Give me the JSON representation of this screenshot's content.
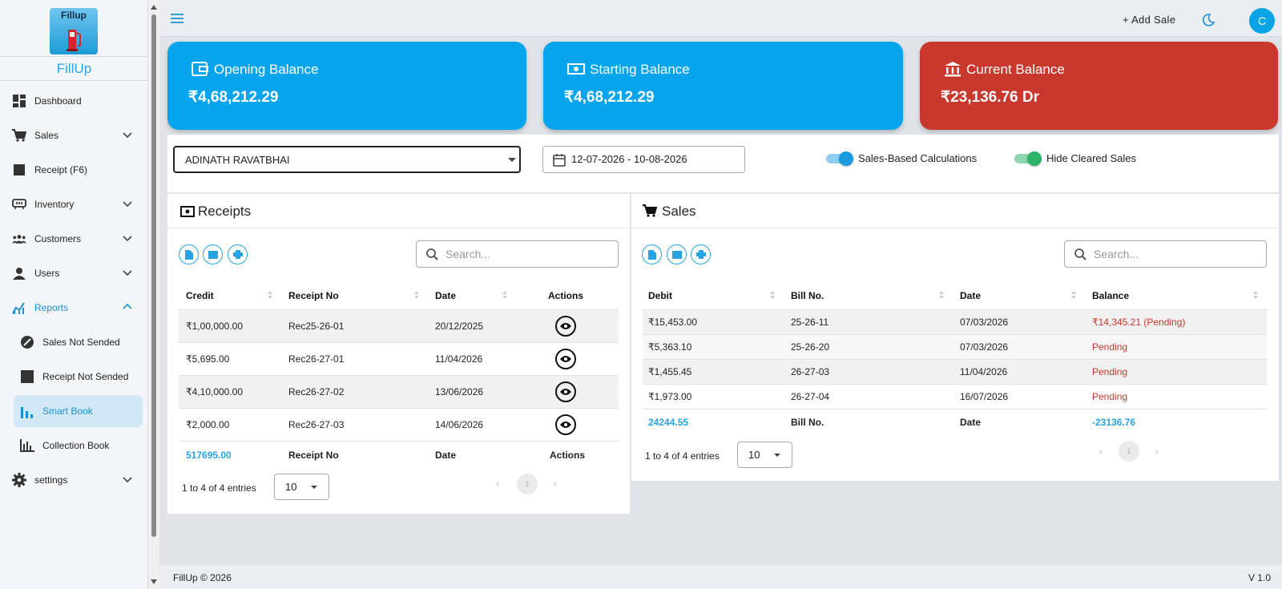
{
  "app": {
    "logo_text": "Fillup",
    "name": "FillUp"
  },
  "sidebar": {
    "items": [
      {
        "label": "Dashboard"
      },
      {
        "label": "Sales"
      },
      {
        "label": "Receipt (F6)"
      },
      {
        "label": "Inventory"
      },
      {
        "label": "Customers"
      },
      {
        "label": "Users"
      },
      {
        "label": "Reports"
      },
      {
        "label": "Sales Not Sended"
      },
      {
        "label": "Receipt Not Sended"
      },
      {
        "label": "Smart Book"
      },
      {
        "label": "Collection Book"
      },
      {
        "label": "settings"
      }
    ]
  },
  "topbar": {
    "add_sale": "+ Add Sale",
    "avatar_letter": "C"
  },
  "cards": [
    {
      "title": "Opening Balance",
      "value": "₹4,68,212.29",
      "color": "#05a4ec"
    },
    {
      "title": "Starting Balance",
      "value": "₹4,68,212.29",
      "color": "#05a4ec"
    },
    {
      "title": "Current Balance",
      "value": "₹23,136.76 Dr",
      "color": "#c8382d"
    }
  ],
  "filters": {
    "customer": "ADINATH RAVATBHAI",
    "date_range": "12-07-2026 - 10-08-2026",
    "toggle1": "Sales-Based Calculations",
    "toggle2": "Hide Cleared Sales"
  },
  "receipts": {
    "title": "Receipts",
    "search_placeholder": "Search...",
    "headers": [
      "Credit",
      "Receipt No",
      "Date",
      "Actions"
    ],
    "rows": [
      [
        "₹1,00,000.00",
        "Rec25-26-01",
        "20/12/2025"
      ],
      [
        "₹5,695.00",
        "Rec26-27-01",
        "11/04/2026"
      ],
      [
        "₹4,10,000.00",
        "Rec26-27-02",
        "13/06/2026"
      ],
      [
        "₹2,000.00",
        "Rec26-27-03",
        "14/06/2026"
      ]
    ],
    "footer": [
      "517695.00",
      "Receipt No",
      "Date",
      "Actions"
    ],
    "entries": "1 to 4 of 4 entries",
    "page_size": "10",
    "page": "1"
  },
  "sales": {
    "title": "Sales",
    "search_placeholder": "Search...",
    "headers": [
      "Debit",
      "Bill No.",
      "Date",
      "Balance"
    ],
    "rows": [
      [
        "₹15,453.00",
        "25-26-11",
        "07/03/2026",
        "₹14,345.21 (Pending)"
      ],
      [
        "₹5,363.10",
        "25-26-20",
        "07/03/2026",
        "Pending"
      ],
      [
        "₹1,455.45",
        "26-27-03",
        "11/04/2026",
        "Pending"
      ],
      [
        "₹1,973.00",
        "26-27-04",
        "16/07/2026",
        "Pending"
      ]
    ],
    "footer": [
      "24244.55",
      "Bill No.",
      "Date",
      "-23136.76"
    ],
    "entries": "1 to 4 of 4 entries",
    "page_size": "10",
    "page": "1"
  },
  "footer": {
    "copyright": "FillUp © 2026",
    "version": "V 1.0"
  },
  "colors": {
    "accent": "#29a3e0",
    "pending": "#c8382d",
    "toggle_blue": "#1a9be0",
    "toggle_green": "#2db36a"
  }
}
